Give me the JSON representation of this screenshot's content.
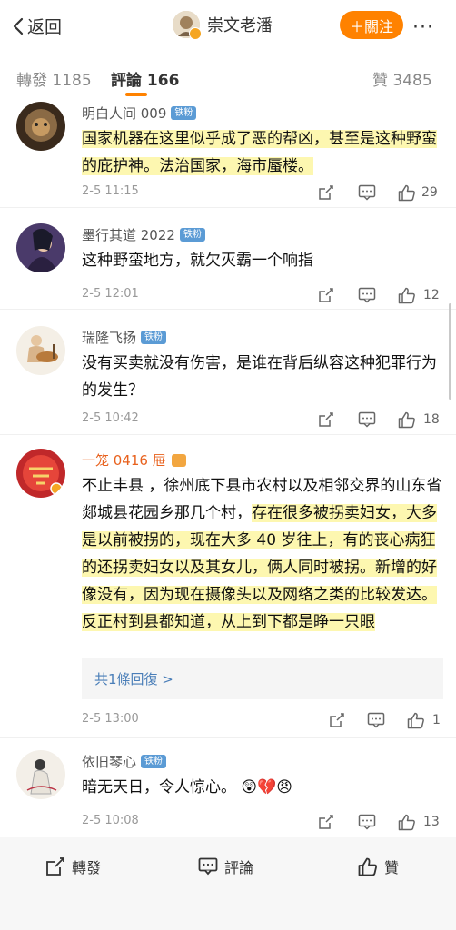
{
  "topbar": {
    "back_label": "返回",
    "author_name": "崇文老潘",
    "follow_label": "＋關注",
    "more_label": "···"
  },
  "tabs": [
    {
      "label": "轉發",
      "count": "1185"
    },
    {
      "label": "評論",
      "count": "166"
    },
    {
      "label": "贊",
      "count": "3485"
    }
  ],
  "comments": [
    {
      "name": "明白人间 009",
      "badge": "铁粉",
      "text": "国家机器在这里似乎成了恶的帮凶，甚至是这种野蛮的庇护神。法治国家，海市蜃楼。",
      "time": "2-5 11:15",
      "likes": "29"
    },
    {
      "name": "墨行其道 2022",
      "badge": "铁粉",
      "text": "这种野蛮地方，就欠灭霸一个响指",
      "time": "2-5 12:01",
      "likes": "12"
    },
    {
      "name": "瑞隆飞扬",
      "badge": "铁粉",
      "text": "没有买卖就没有伤害，是谁在背后纵容这种犯罪行为的发生？",
      "time": "2-5 10:42",
      "likes": "18"
    },
    {
      "name": "一笼 0416 屉",
      "text_a": "不止丰县 ，徐州底下县市农村以及相邻交界的山东省郯城县花园乡那几个村，",
      "text_b": "存在很多被拐卖妇女，大多是以前被拐的，现在大多 40 岁往上，有的丧心病狂的还拐卖妇女以及其女儿，俩人同时被拐。新增的好像没有，因为现在摄像头以及网络之类的比较发达。 反正村到县都知道，从上到下都是睁一只眼",
      "reply_label": "共1條回復 >",
      "time": "2-5 13:00",
      "likes": "1"
    },
    {
      "name": "依旧琴心",
      "badge": "铁粉",
      "text": "暗无天日，令人惊心。",
      "emojis": "😲💔😠",
      "time": "2-5 10:08",
      "likes": "13"
    }
  ],
  "bottombar": {
    "repost_label": "轉發",
    "comment_label": "評論",
    "like_label": "贊"
  }
}
